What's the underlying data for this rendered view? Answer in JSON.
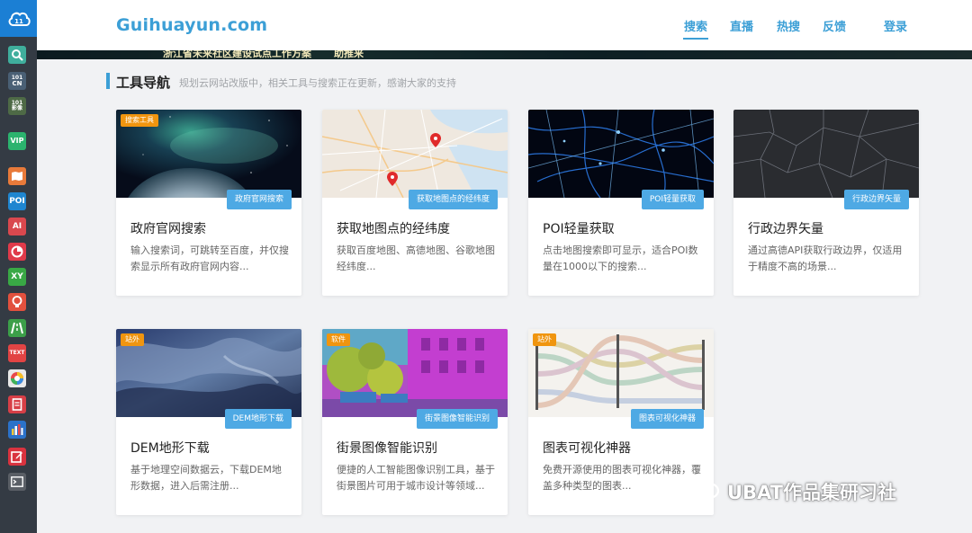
{
  "site": {
    "logo": "Guihuayun.com"
  },
  "nav": [
    "搜索",
    "直播",
    "热搜",
    "反馈",
    "登录"
  ],
  "banner": {
    "text_left": "浙江省未来社区建设试点工作方案",
    "text_right": "助推来"
  },
  "section": {
    "title": "工具导航",
    "description": "规划云网站改版中，相关工具与搜索正在更新，感谢大家的支持"
  },
  "sidebar_icons": [
    {
      "name": "cloud-logo-icon",
      "label": ""
    },
    {
      "name": "search-icon",
      "label": ""
    },
    {
      "name": "tianditu-cn-icon",
      "label": "CN"
    },
    {
      "name": "tianditu-image-icon",
      "label": "影像"
    },
    {
      "name": "vip-icon",
      "label": "VIP"
    },
    {
      "name": "map-icon",
      "label": ""
    },
    {
      "name": "poi-icon",
      "label": "POI"
    },
    {
      "name": "ai-icon",
      "label": "AI"
    },
    {
      "name": "pie-chart-icon",
      "label": ""
    },
    {
      "name": "xy-coordinate-icon",
      "label": "XY"
    },
    {
      "name": "idea-bulb-icon",
      "label": ""
    },
    {
      "name": "road-icon",
      "label": ""
    },
    {
      "name": "text-icon",
      "label": "TEXT"
    },
    {
      "name": "color-wheel-icon",
      "label": ""
    },
    {
      "name": "document-icon",
      "label": ""
    },
    {
      "name": "bar-chart-icon",
      "label": ""
    },
    {
      "name": "edit-icon",
      "label": ""
    },
    {
      "name": "terminal-icon",
      "label": ""
    }
  ],
  "cards": [
    {
      "title": "政府官网搜索",
      "desc": "输入搜索词，可跳转至百度，并仅搜索显示所有政府官网内容...",
      "badge": "政府官网搜索",
      "tag": "搜索工具"
    },
    {
      "title": "获取地图点的经纬度",
      "desc": "获取百度地图、高德地图、谷歌地图经纬度...",
      "badge": "获取地图点的经纬度",
      "tag": ""
    },
    {
      "title": "POI轻量获取",
      "desc": "点击地图搜索即可显示，适合POI数量在1000以下的搜索...",
      "badge": "POI轻量获取",
      "tag": ""
    },
    {
      "title": "行政边界矢量",
      "desc": "通过高德API获取行政边界，仅适用于精度不高的场景...",
      "badge": "行政边界矢量",
      "tag": ""
    },
    {
      "title": "DEM地形下载",
      "desc": "基于地理空间数据云，下载DEM地形数据，进入后需注册...",
      "badge": "DEM地形下载",
      "tag": "站外"
    },
    {
      "title": "街景图像智能识别",
      "desc": "便捷的人工智能图像识别工具，基于街景图片可用于城市设计等领域...",
      "badge": "街景图像智能识别",
      "tag": "软件"
    },
    {
      "title": "图表可视化神器",
      "desc": "免费开源使用的图表可视化神器，覆盖多种类型的图表...",
      "badge": "图表可视化神器",
      "tag": "站外"
    }
  ],
  "watermark": "UBAT作品集研习社",
  "colors": {
    "accent": "#3c9fd6",
    "badge": "#4ea9e4",
    "tag": "#f0950f",
    "sidebar": "#343b44"
  }
}
